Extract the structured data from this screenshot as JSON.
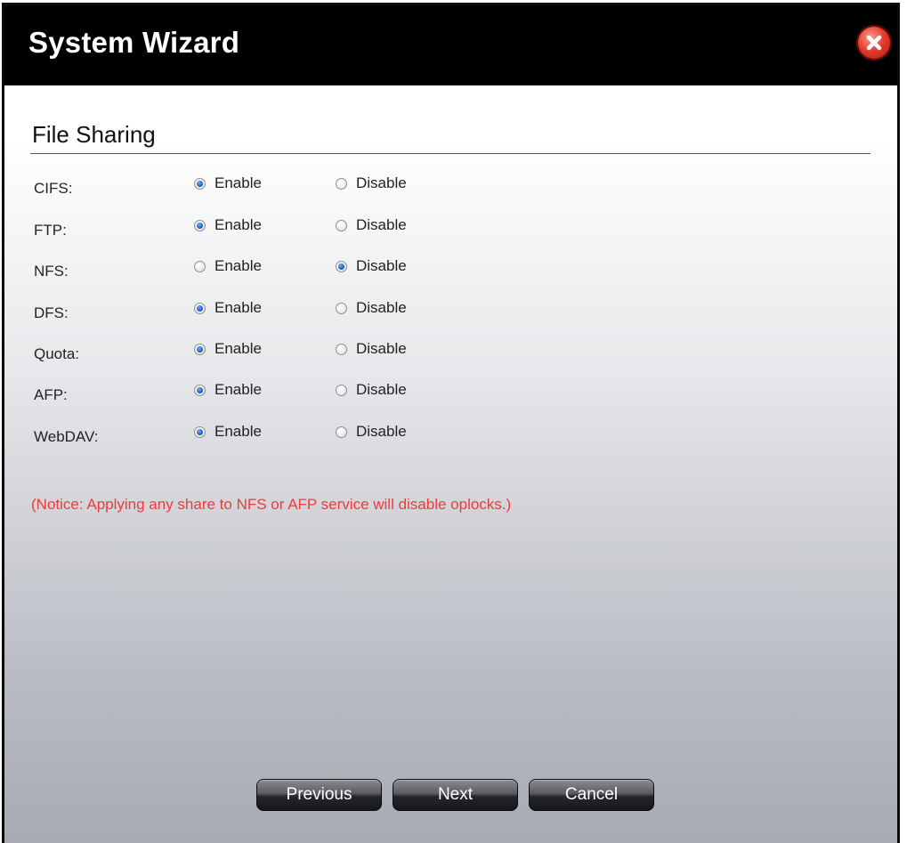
{
  "window": {
    "title": "System Wizard"
  },
  "section": {
    "title": "File Sharing"
  },
  "options": {
    "enable_label": "Enable",
    "disable_label": "Disable"
  },
  "services": [
    {
      "label": "CIFS:",
      "selected": "Enable"
    },
    {
      "label": "FTP:",
      "selected": "Enable"
    },
    {
      "label": "NFS:",
      "selected": "Disable"
    },
    {
      "label": "DFS:",
      "selected": "Enable"
    },
    {
      "label": "Quota:",
      "selected": "Enable"
    },
    {
      "label": "AFP:",
      "selected": "Enable"
    },
    {
      "label": "WebDAV:",
      "selected": "Enable"
    }
  ],
  "notice": "(Notice: Applying any share to NFS or AFP service will disable oplocks.)",
  "buttons": {
    "previous": "Previous",
    "next": "Next",
    "cancel": "Cancel"
  },
  "colors": {
    "notice": "#ee3b3b",
    "titlebar": "#000000",
    "close": "#e03a2b",
    "radio_checked": "#1b5fc4"
  },
  "icons": {
    "close": "close-icon"
  }
}
